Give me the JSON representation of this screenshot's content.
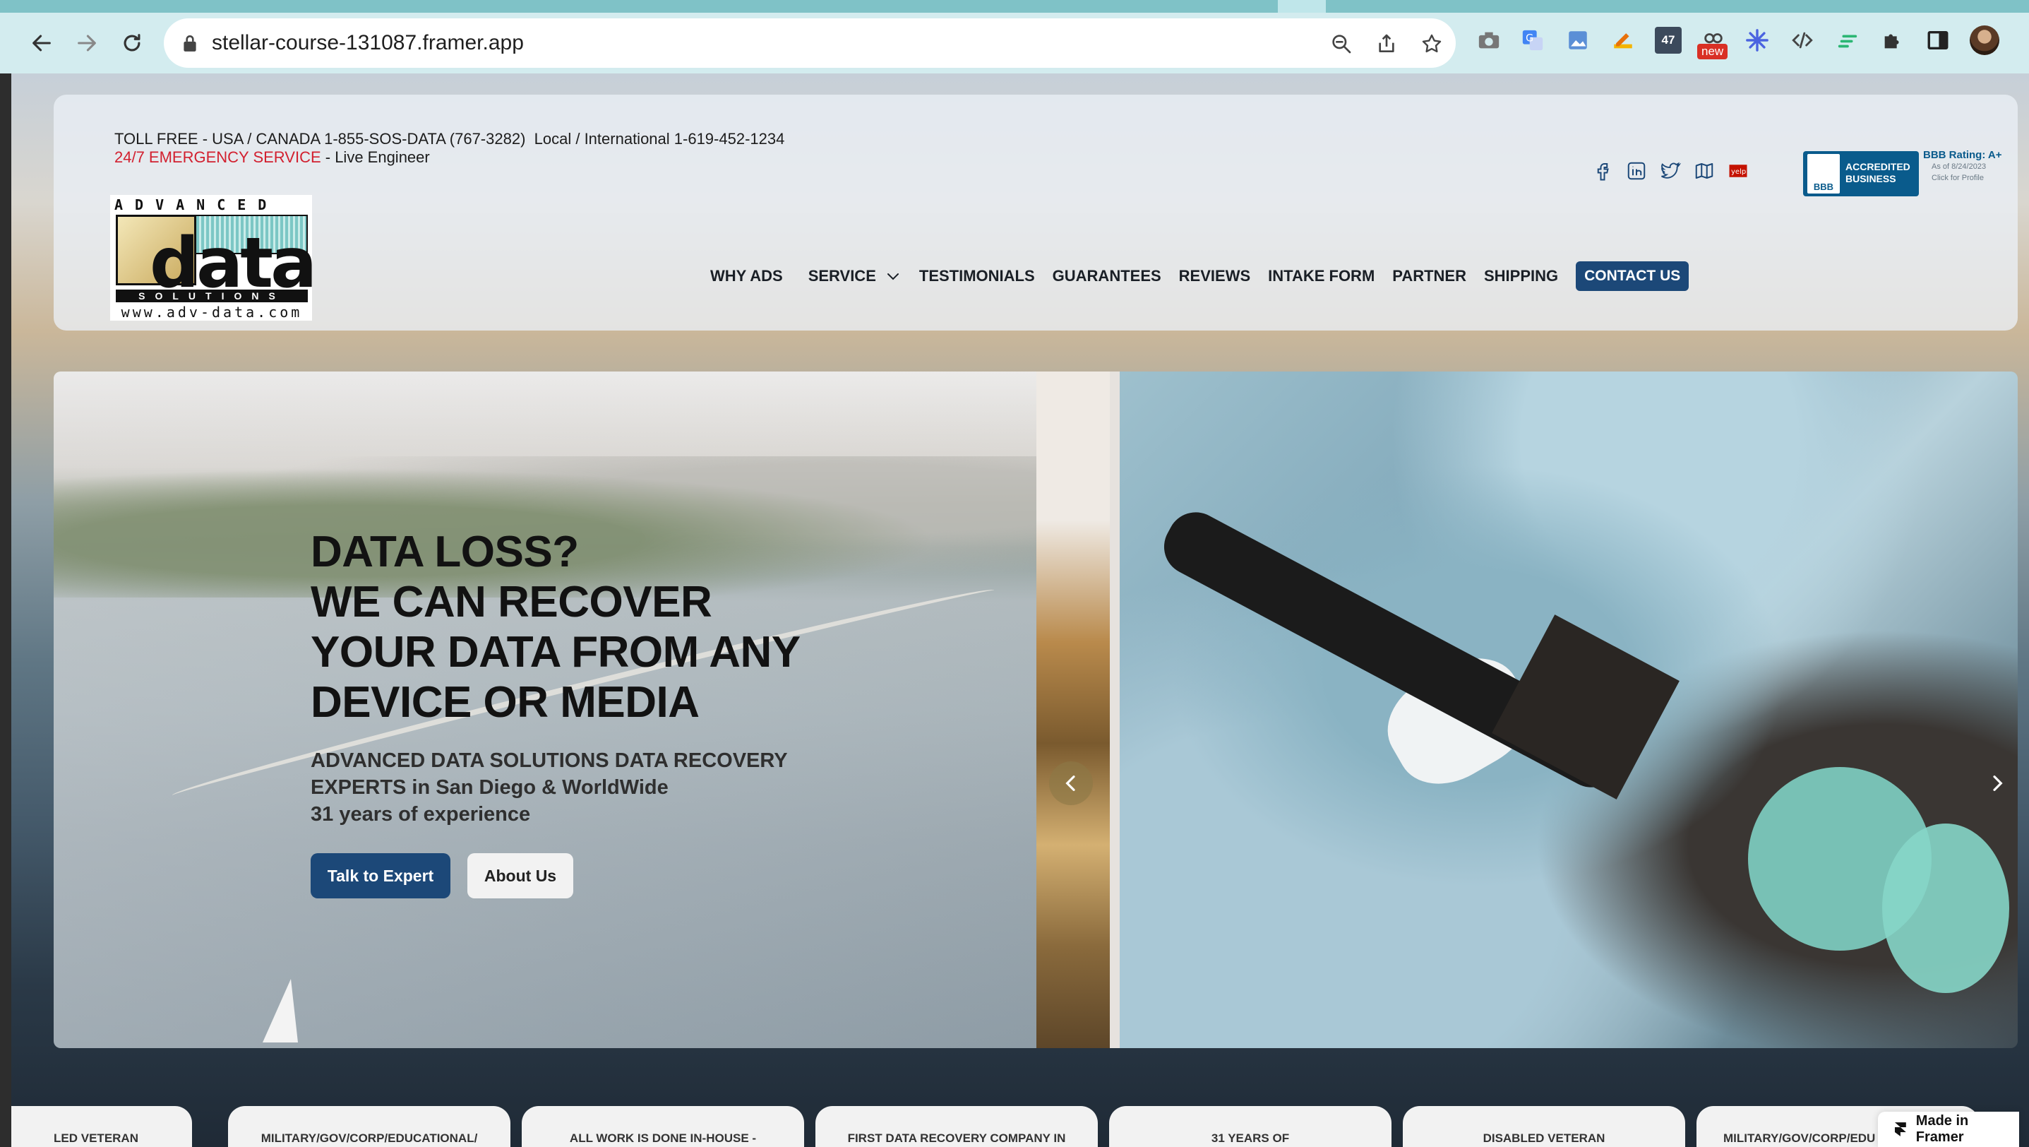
{
  "browser": {
    "url": "stellar-course-131087.framer.app",
    "extension_badge": "new",
    "extension_counter": "47"
  },
  "header": {
    "toll_free": "TOLL FREE - USA / CANADA 1-855-SOS-DATA (767-3282)",
    "international": "Local / International 1-619-452-1234",
    "emergency": "24/7 EMERGENCY SERVICE",
    "emergency_suffix": " - Live Engineer",
    "logo": {
      "top": "ADVANCED",
      "word": "data",
      "solutions": "SOLUTIONS",
      "url": "www.adv-data.com"
    },
    "bbb": {
      "seal": "BBB",
      "accredited": "ACCREDITED",
      "business": "BUSINESS",
      "rating": "BBB Rating: A+",
      "as_of": "As of 8/24/2023",
      "click": "Click for Profile"
    }
  },
  "nav": {
    "items": [
      "WHY ADS",
      "SERVICE",
      "TESTIMONIALS",
      "GUARANTEES",
      "REVIEWS",
      "INTAKE FORM",
      "PARTNER",
      "SHIPPING"
    ],
    "contact": "CONTACT US"
  },
  "hero": {
    "title_lines": [
      "DATA LOSS?",
      "WE CAN RECOVER",
      "YOUR DATA FROM ANY",
      "DEVICE OR MEDIA"
    ],
    "sub_lines": [
      "ADVANCED DATA SOLUTIONS DATA RECOVERY",
      "EXPERTS in San Diego & WorldWide",
      "31 years of experience"
    ],
    "btn_expert": "Talk to Expert",
    "btn_about": "About Us"
  },
  "features": [
    "LED VETERAN",
    "MILITARY/GOV/CORP/EDUCATIONAL/",
    "ALL WORK IS DONE IN-HOUSE -",
    "FIRST DATA RECOVERY COMPANY IN",
    "31 YEARS OF",
    "DISABLED VETERAN",
    "MILITARY/GOV/CORP/EDU"
  ],
  "framer_badge": "Made in Framer",
  "colors": {
    "brand_blue": "#1c4878",
    "emergency_red": "#d2202f",
    "bbb_blue": "#0a5b8c"
  },
  "icons": {
    "social": [
      "facebook-icon",
      "linkedin-icon",
      "twitter-icon",
      "map-icon",
      "yelp-icon"
    ]
  }
}
